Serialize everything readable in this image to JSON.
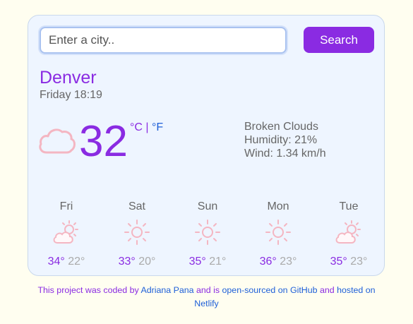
{
  "search": {
    "placeholder": "Enter a city..",
    "button_label": "Search"
  },
  "current": {
    "city": "Denver",
    "datetime": "Friday 18:19",
    "temperature": "32",
    "unit_celsius": "°C",
    "unit_separator": "|",
    "unit_fahrenheit": "°F",
    "description": "Broken Clouds",
    "humidity": "Humidity: 21%",
    "wind": "Wind: 1.34 km/h",
    "icon": "cloud-icon"
  },
  "forecast": [
    {
      "day": "Fri",
      "max": "34°",
      "min": "22°",
      "icon": "partly-cloudy-icon"
    },
    {
      "day": "Sat",
      "max": "33°",
      "min": "20°",
      "icon": "sun-icon"
    },
    {
      "day": "Sun",
      "max": "35°",
      "min": "21°",
      "icon": "sun-icon"
    },
    {
      "day": "Mon",
      "max": "36°",
      "min": "23°",
      "icon": "sun-icon"
    },
    {
      "day": "Tue",
      "max": "35°",
      "min": "23°",
      "icon": "partly-cloudy-icon"
    }
  ],
  "footer": {
    "text_1": "This project was coded by ",
    "author_link": "Adriana Pana",
    "text_2": " and is ",
    "github_link": "open-sourced on GitHub",
    "text_3": " and ",
    "netlify_link": "hosted on Netlify"
  },
  "colors": {
    "accent": "#8a2be2",
    "link": "#1e5fd8",
    "icon": "#f4b6c2",
    "card_bg": "#eef5ff",
    "page_bg": "#fffef0"
  }
}
